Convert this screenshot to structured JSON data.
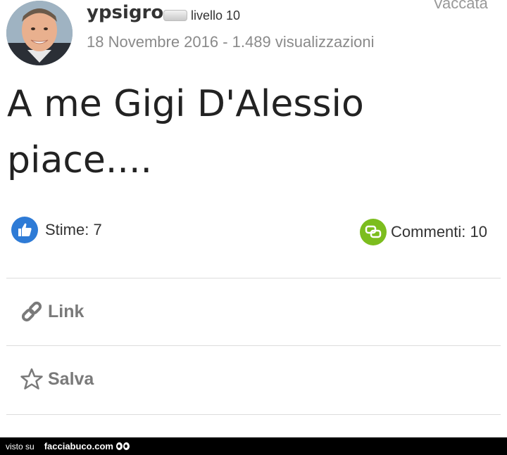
{
  "post": {
    "author": "ypsigro",
    "level": "livello 10",
    "vote_label": "Vaccata",
    "meta": "18 Novembre 2016 - 1.489 visualizzazioni",
    "title_line1": "A me Gigi D'Alessio",
    "title_line2": "piace...."
  },
  "stats": {
    "stime": "Stime: 7",
    "commenti": "Commenti: 10"
  },
  "actions": {
    "link": "Link",
    "salva": "Salva"
  },
  "footer": {
    "visto_su": "visto su",
    "brand": "facciabuco.com"
  },
  "icons": {
    "thumbs_up": "thumbs-up-icon",
    "comment": "comment-icon",
    "link": "link-icon",
    "star": "star-icon"
  },
  "colors": {
    "thumbs_blue": "#2e7bd6",
    "comment_green": "#7cbd1e",
    "meta_gray": "#8a8a8a",
    "action_gray": "#7a7a7a"
  }
}
